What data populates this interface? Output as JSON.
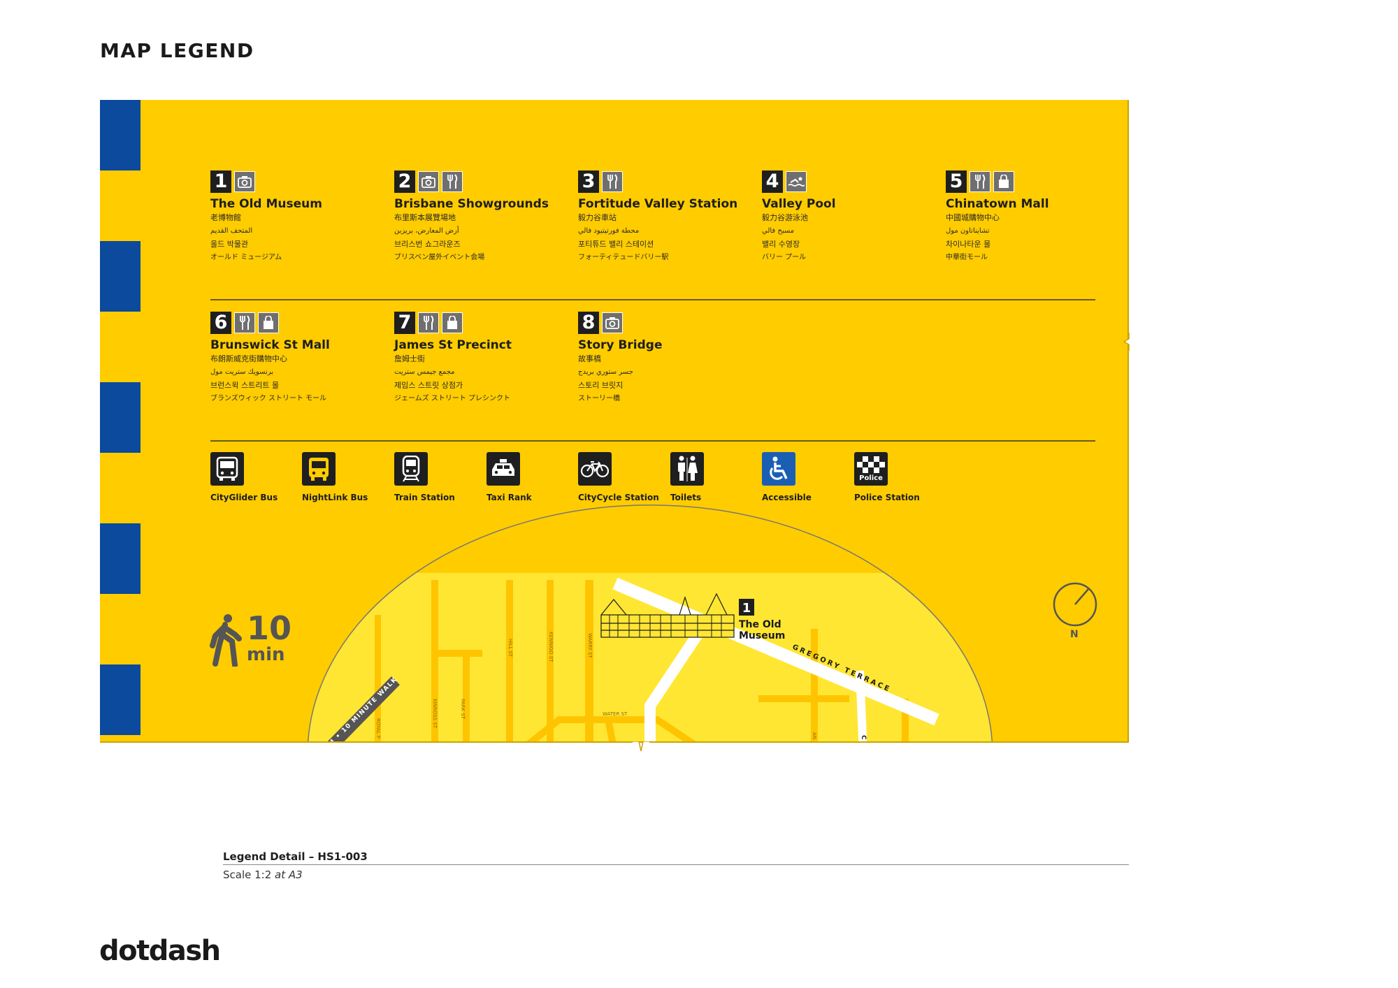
{
  "page_title": "MAP LEGEND",
  "colors": {
    "panel": "#ffcc00",
    "stripe": "#0b4a9c",
    "map_land": "#ffe633",
    "map_road": "#ffc400",
    "icon_dark": "#1f1f1f",
    "icon_grey": "#6f6f6f",
    "accessible": "#1a5fb4"
  },
  "attractions": [
    {
      "num": "1",
      "icons": [
        "museum-icon"
      ],
      "name": "The Old Museum",
      "zh": "老博物館",
      "ar": "المتحف القديم",
      "ko": "올드 박물관",
      "ja": "オールド ミュージアム"
    },
    {
      "num": "2",
      "icons": [
        "museum-icon",
        "food-icon"
      ],
      "name": "Brisbane Showgrounds",
      "zh": "布里斯本展覽場地",
      "ar": "أرض المعارض، بريزبن",
      "ko": "브리스번 쇼그라운즈",
      "ja": "ブリスベン屋外イベント会場"
    },
    {
      "num": "3",
      "icons": [
        "food-icon"
      ],
      "name": "Fortitude Valley Station",
      "zh": "毅力谷車站",
      "ar": "محطة فورتيتيود فالي",
      "ko": "포티튜드 밸리 스테이션",
      "ja": "フォーティテュードバリー駅"
    },
    {
      "num": "4",
      "icons": [
        "swimming-icon"
      ],
      "name": "Valley Pool",
      "zh": "毅力谷游泳池",
      "ar": "مسبح فالي",
      "ko": "밸리 수영장",
      "ja": "バリー プール"
    },
    {
      "num": "5",
      "icons": [
        "food-icon",
        "shopping-icon"
      ],
      "name": "Chinatown Mall",
      "zh": "中國城購物中心",
      "ar": "تشايناتاون مول",
      "ko": "차이나타운 몰",
      "ja": "中華街モール"
    },
    {
      "num": "6",
      "icons": [
        "food-icon",
        "shopping-icon"
      ],
      "name": "Brunswick St Mall",
      "zh": "布朗斯威克街購物中心",
      "ar": "برنسويك ستريت مول",
      "ko": "브런스윅 스트리트 몰",
      "ja": "ブランズウィック ストリート モール"
    },
    {
      "num": "7",
      "icons": [
        "food-icon",
        "shopping-icon"
      ],
      "name": "James St Precinct",
      "zh": "詹姆士街",
      "ar": "مجمع جيمس ستريت",
      "ko": "제임스 스트릿 상점가",
      "ja": "ジェームズ ストリート プレシンクト"
    },
    {
      "num": "8",
      "icons": [
        "museum-icon"
      ],
      "name": "Story Bridge",
      "zh": "故事橋",
      "ar": "جسر ستوري بريدج",
      "ko": "스토리 브릿지",
      "ja": "ストーリー橋"
    }
  ],
  "services": [
    {
      "icon": "bus-icon",
      "label": "CityGlider Bus"
    },
    {
      "icon": "bus-icon",
      "label": "NightLink Bus"
    },
    {
      "icon": "train-icon",
      "label": "Train Station"
    },
    {
      "icon": "taxi-icon",
      "label": "Taxi Rank"
    },
    {
      "icon": "bicycle-icon",
      "label": "CityCycle Station"
    },
    {
      "icon": "toilets-icon",
      "label": "Toilets"
    },
    {
      "icon": "accessible-icon",
      "label": "Accessible"
    },
    {
      "icon": "police-icon",
      "label": "Police Station",
      "badge": "Police"
    }
  ],
  "walk": {
    "value": "10",
    "unit": "min",
    "ring_label": "M • 10 MINUTE WALK"
  },
  "compass": {
    "label": "N"
  },
  "map": {
    "streets": [
      "HILL ST",
      "KENNIGO ST",
      "WARRY ST",
      "ROYAL P",
      "KINROSS ST",
      "PARK ST",
      "WATER ST",
      "GREGORY TERRACE",
      "AN",
      "C"
    ],
    "landmark": {
      "num": "1",
      "name_line1": "The Old",
      "name_line2": "Museum"
    }
  },
  "footer": {
    "title": "Legend Detail – HS1-003",
    "scale_prefix": "Scale 1:2",
    "scale_suffix": "at A3"
  },
  "brand": "dotdash"
}
